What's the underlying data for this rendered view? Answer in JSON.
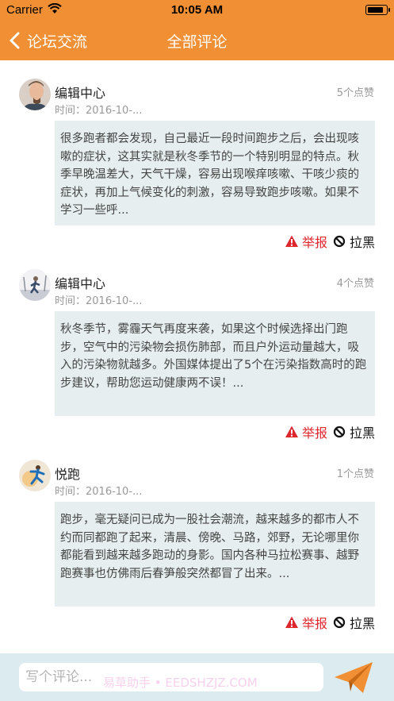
{
  "status_bar": {
    "carrier": "Carrier",
    "time": "10:05 AM",
    "battery_level": 0.9
  },
  "navbar": {
    "back_label": "论坛交流",
    "title": "全部评论"
  },
  "theme": {
    "accent": "#f08f34",
    "report_color": "#e0262d",
    "content_bg": "#e6eef0"
  },
  "comments": [
    {
      "user": "编辑中心",
      "time": "时间：2016-10-...",
      "likes": "5个点赞",
      "text": "很多跑者都会发现，自己最近一段时间跑步之后，会出现咳嗽的症状，这其实就是秋冬季节的一个特别明显的特点。秋季早晚温差大，天气干燥，容易出现喉痒咳嗽、干咳少痰的症状，再加上气候变化的刺激，容易导致跑步咳嗽。如果不学习一些呼...",
      "report": "举报",
      "block": "拉黑"
    },
    {
      "user": "编辑中心",
      "time": "时间：2016-10-...",
      "likes": "4个点赞",
      "text": "秋冬季节，雾霾天气再度来袭，如果这个时候选择出门跑步，空气中的污染物会损伤肺部，而且户外运动量越大，吸入的污染物就越多。外国媒体提出了5个在污染指数高时的跑步建议，帮助您运动健康两不误！...",
      "report": "举报",
      "block": "拉黑"
    },
    {
      "user": "悦跑",
      "time": "时间：2016-10-...",
      "likes": "1个点赞",
      "text": "跑步，毫无疑问已成为一股社会潮流，越来越多的都市人不约而同都跑了起来，清晨、傍晚、马路，郊野，无论哪里你都能看到越来越多跑动的身影。国内各种马拉松赛事、越野跑赛事也仿佛雨后春笋般突然都冒了出来。...",
      "report": "举报",
      "block": "拉黑"
    }
  ],
  "input": {
    "placeholder": "写个评论...",
    "value": "",
    "watermark": "易草助手 • EEDSHZJZ.COM"
  }
}
